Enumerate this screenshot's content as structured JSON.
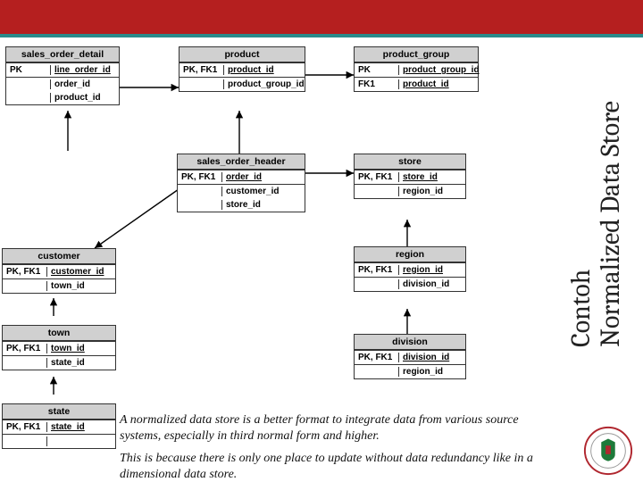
{
  "title": {
    "line1": "Contoh",
    "line2": "Normalized Data Store"
  },
  "paragraphs": {
    "p1": "A normalized data store is a better format to integrate data from various source systems, especially in third normal form and higher.",
    "p2": "This is because there is only one place to update without data redundancy like in a dimensional data store."
  },
  "entities": {
    "sales_order_detail": {
      "title": "sales_order_detail",
      "pk": {
        "key": "PK",
        "field": "line_order_id"
      },
      "attrs": [
        "order_id",
        "product_id"
      ]
    },
    "product": {
      "title": "product",
      "pk": {
        "key": "PK, FK1",
        "field": "product_id"
      },
      "attrs": [
        "product_group_id"
      ]
    },
    "product_group": {
      "title": "product_group",
      "pk": {
        "key": "PK",
        "field": "product_group_id"
      },
      "fk": {
        "key": "FK1",
        "field": "product_id"
      }
    },
    "sales_order_header": {
      "title": "sales_order_header",
      "pk": {
        "key": "PK, FK1",
        "field": "order_id"
      },
      "attrs": [
        "customer_id",
        "store_id"
      ]
    },
    "store": {
      "title": "store",
      "pk": {
        "key": "PK, FK1",
        "field": "store_id"
      },
      "attrs": [
        "region_id"
      ]
    },
    "customer": {
      "title": "customer",
      "pk": {
        "key": "PK, FK1",
        "field": "customer_id"
      },
      "attrs": [
        "town_id"
      ]
    },
    "region": {
      "title": "region",
      "pk": {
        "key": "PK, FK1",
        "field": "region_id"
      },
      "attrs": [
        "division_id"
      ]
    },
    "town": {
      "title": "town",
      "pk": {
        "key": "PK, FK1",
        "field": "town_id"
      },
      "attrs": [
        "state_id"
      ]
    },
    "division": {
      "title": "division",
      "pk": {
        "key": "PK, FK1",
        "field": "division_id"
      },
      "attrs": [
        "region_id"
      ]
    },
    "state": {
      "title": "state",
      "pk": {
        "key": "PK, FK1",
        "field": "state_id"
      }
    }
  }
}
